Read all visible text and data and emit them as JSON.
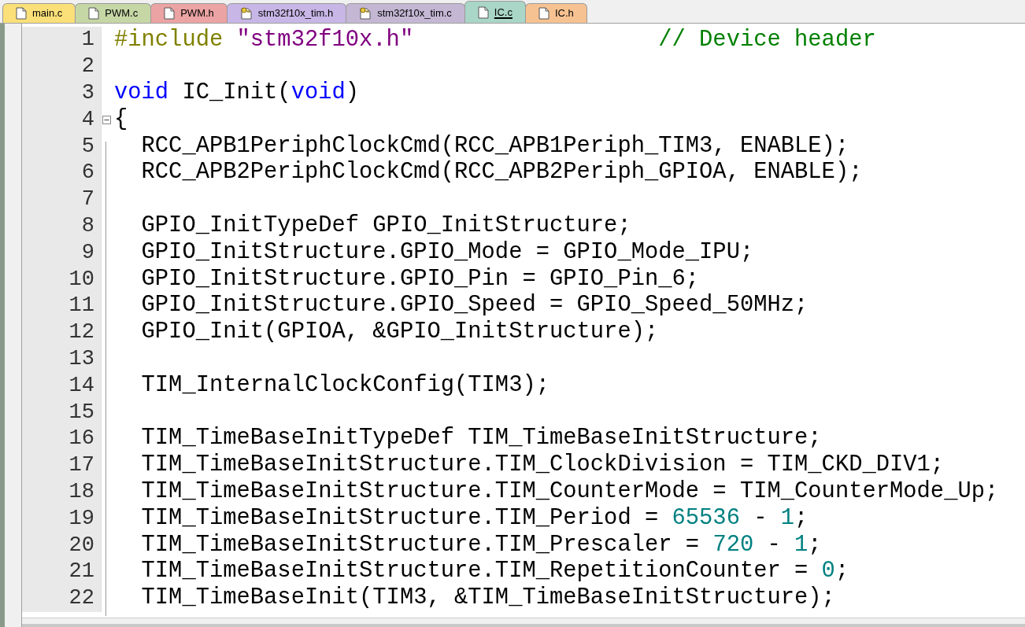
{
  "tabs": [
    {
      "label": "main.c",
      "kind": "file",
      "color": "#fbe07a",
      "selected": false
    },
    {
      "label": "PWM.c",
      "kind": "file",
      "color": "#c6d7a6",
      "selected": false
    },
    {
      "label": "PWM.h",
      "kind": "file",
      "color": "#eba3a3",
      "selected": false
    },
    {
      "label": "stm32f10x_tim.h",
      "kind": "key",
      "color": "#c7b6e6",
      "selected": false
    },
    {
      "label": "stm32f10x_tim.c",
      "kind": "key",
      "color": "#c4b7d4",
      "selected": false
    },
    {
      "label": "IC.c",
      "kind": "file",
      "color": "#a9d6c6",
      "selected": true
    },
    {
      "label": "IC.h",
      "kind": "file",
      "color": "#f7c291",
      "selected": false
    }
  ],
  "editor": {
    "lines": [
      {
        "number": "1",
        "tokens": [
          {
            "kind": "preprocessor",
            "text": "#include "
          },
          {
            "kind": "string",
            "text": "\"stm32f10x.h\""
          },
          {
            "kind": "comment",
            "text": "                  // Device header"
          }
        ]
      },
      {
        "number": "2"
      },
      {
        "number": "3",
        "tokens": [
          {
            "kind": "keyword",
            "text": "void"
          },
          {
            "kind": "plain",
            "text": " IC_Init("
          },
          {
            "kind": "keyword",
            "text": "void"
          },
          {
            "kind": "plain",
            "text": ")"
          }
        ]
      },
      {
        "number": "4",
        "fold": true,
        "tokens": [
          {
            "kind": "plain",
            "text": "{"
          }
        ]
      },
      {
        "number": "5",
        "tokens": [
          {
            "kind": "plain",
            "text": "  RCC_APB1PeriphClockCmd(RCC_APB1Periph_TIM3, ENABLE);"
          }
        ]
      },
      {
        "number": "6",
        "tokens": [
          {
            "kind": "plain",
            "text": "  RCC_APB2PeriphClockCmd(RCC_APB2Periph_GPIOA, ENABLE);"
          }
        ]
      },
      {
        "number": "7"
      },
      {
        "number": "8",
        "tokens": [
          {
            "kind": "plain",
            "text": "  GPIO_InitTypeDef GPIO_InitStructure;"
          }
        ]
      },
      {
        "number": "9",
        "tokens": [
          {
            "kind": "plain",
            "text": "  GPIO_InitStructure.GPIO_Mode = GPIO_Mode_IPU;"
          }
        ]
      },
      {
        "number": "10",
        "tokens": [
          {
            "kind": "plain",
            "text": "  GPIO_InitStructure.GPIO_Pin = GPIO_Pin_6;"
          }
        ]
      },
      {
        "number": "11",
        "tokens": [
          {
            "kind": "plain",
            "text": "  GPIO_InitStructure.GPIO_Speed = GPIO_Speed_50MHz;"
          }
        ]
      },
      {
        "number": "12",
        "tokens": [
          {
            "kind": "plain",
            "text": "  GPIO_Init(GPIOA, &GPIO_InitStructure);"
          }
        ]
      },
      {
        "number": "13"
      },
      {
        "number": "14",
        "tokens": [
          {
            "kind": "plain",
            "text": "  TIM_InternalClockConfig(TIM3);"
          }
        ]
      },
      {
        "number": "15"
      },
      {
        "number": "16",
        "tokens": [
          {
            "kind": "plain",
            "text": "  TIM_TimeBaseInitTypeDef TIM_TimeBaseInitStructure;"
          }
        ]
      },
      {
        "number": "17",
        "tokens": [
          {
            "kind": "plain",
            "text": "  TIM_TimeBaseInitStructure.TIM_ClockDivision = TIM_CKD_DIV1;"
          }
        ]
      },
      {
        "number": "18",
        "tokens": [
          {
            "kind": "plain",
            "text": "  TIM_TimeBaseInitStructure.TIM_CounterMode = TIM_CounterMode_Up;"
          }
        ]
      },
      {
        "number": "19",
        "tokens": [
          {
            "kind": "plain",
            "text": "  TIM_TimeBaseInitStructure.TIM_Period = "
          },
          {
            "kind": "number",
            "text": "65536"
          },
          {
            "kind": "plain",
            "text": " - "
          },
          {
            "kind": "number",
            "text": "1"
          },
          {
            "kind": "plain",
            "text": ";"
          }
        ]
      },
      {
        "number": "20",
        "tokens": [
          {
            "kind": "plain",
            "text": "  TIM_TimeBaseInitStructure.TIM_Prescaler = "
          },
          {
            "kind": "number",
            "text": "720"
          },
          {
            "kind": "plain",
            "text": " - "
          },
          {
            "kind": "number",
            "text": "1"
          },
          {
            "kind": "plain",
            "text": ";"
          }
        ]
      },
      {
        "number": "21",
        "tokens": [
          {
            "kind": "plain",
            "text": "  TIM_TimeBaseInitStructure.TIM_RepetitionCounter = "
          },
          {
            "kind": "number",
            "text": "0"
          },
          {
            "kind": "plain",
            "text": ";"
          }
        ]
      },
      {
        "number": "22",
        "tokens": [
          {
            "kind": "plain",
            "text": "  TIM_TimeBaseInit(TIM3, &TIM_TimeBaseInitStructure);"
          }
        ]
      }
    ]
  }
}
